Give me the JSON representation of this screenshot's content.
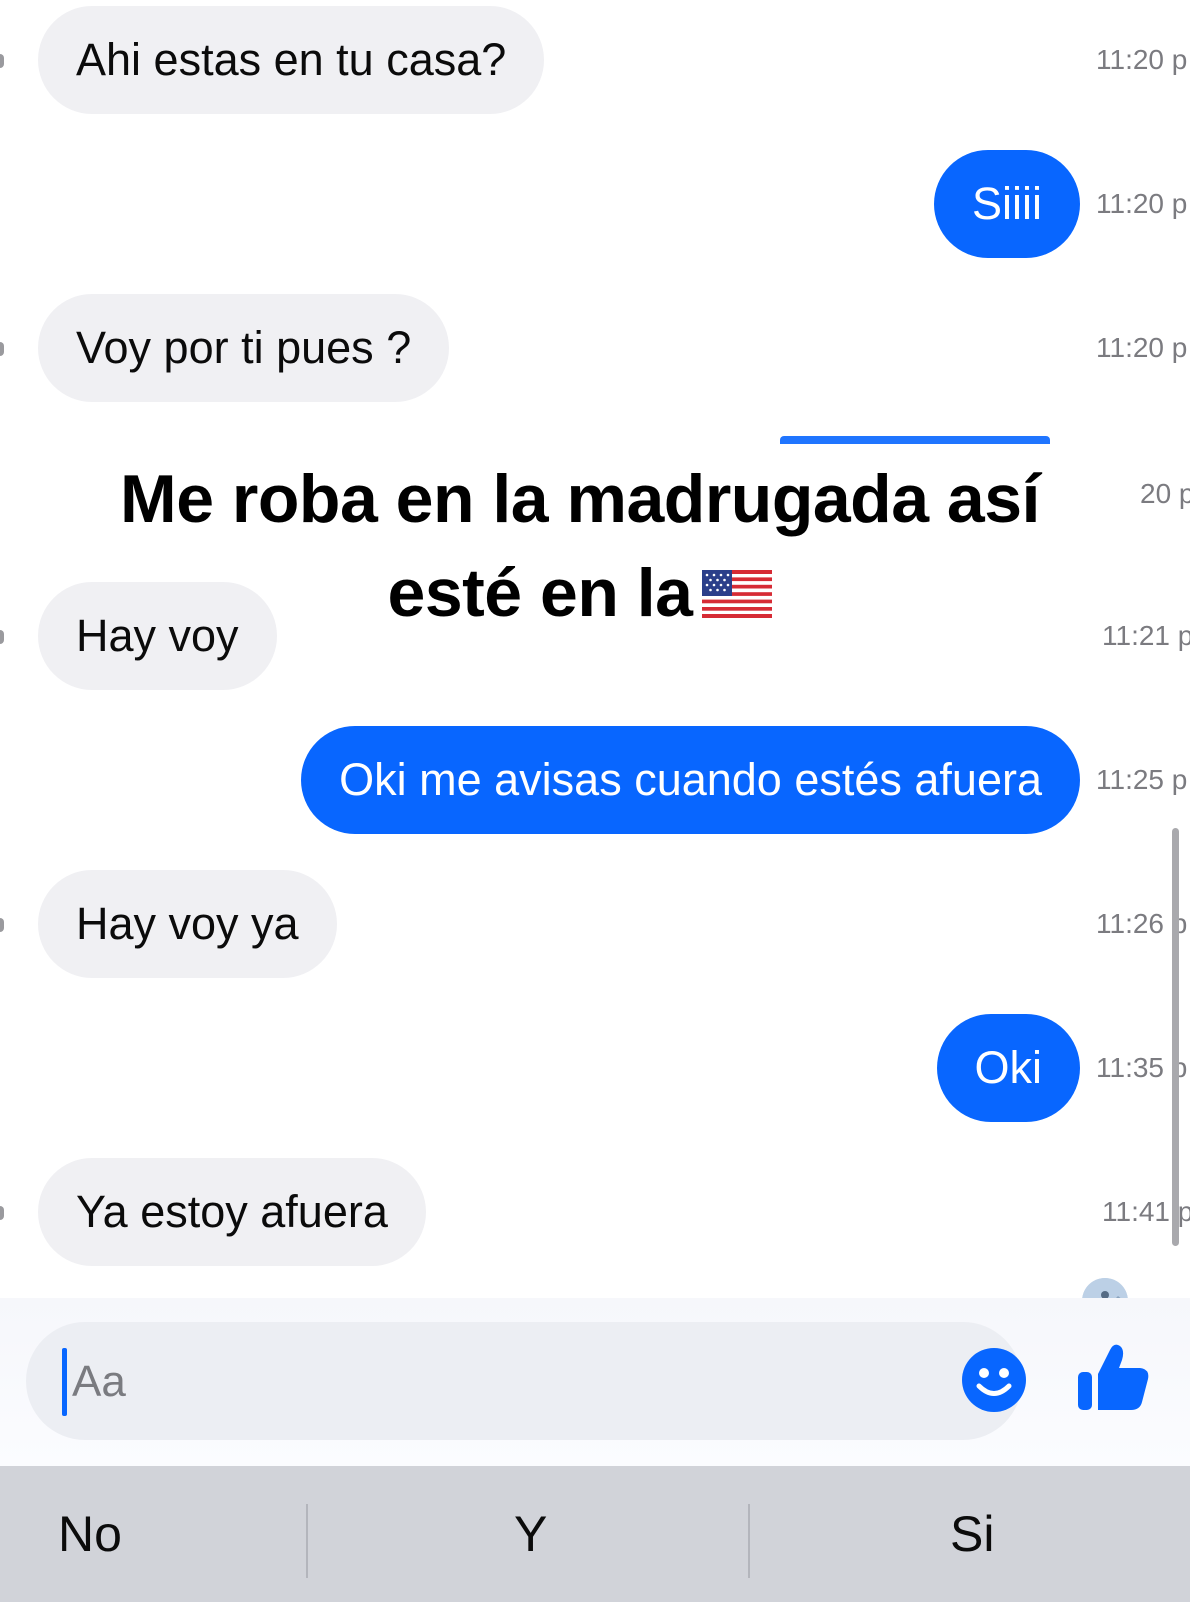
{
  "messages": [
    {
      "text": "Ahi estas en tu casa?",
      "time": "11:20 p",
      "direction": "in"
    },
    {
      "text": "Siiii",
      "time": "11:20 p",
      "direction": "out"
    },
    {
      "text": "Voy por ti pues ?",
      "time": "11:20 p",
      "direction": "in"
    },
    {
      "text": "Hay voy",
      "time": "11:21 p",
      "direction": "in"
    },
    {
      "text": "Oki me avisas cuando estés afuera",
      "time": "11:25 p",
      "direction": "out"
    },
    {
      "text": "Hay voy ya",
      "time": "11:26 p",
      "direction": "in"
    },
    {
      "text": "Oki",
      "time": "11:35 p",
      "direction": "out"
    },
    {
      "text": "Ya estoy afuera",
      "time": "11:41 p",
      "direction": "in"
    }
  ],
  "partial_time": "20 p",
  "overlay": {
    "line1": "Me roba en la madrugada así",
    "line2": "esté en la"
  },
  "composer": {
    "placeholder": "Aa",
    "emoji_icon": "smiley-icon",
    "like_icon": "thumbs-up-icon"
  },
  "keyboard": {
    "suggestions": [
      "No",
      "Y",
      "Si"
    ]
  },
  "colors": {
    "outgoing_bubble": "#0866ff",
    "incoming_bubble": "#f0f0f3",
    "accent": "#0866ff"
  }
}
